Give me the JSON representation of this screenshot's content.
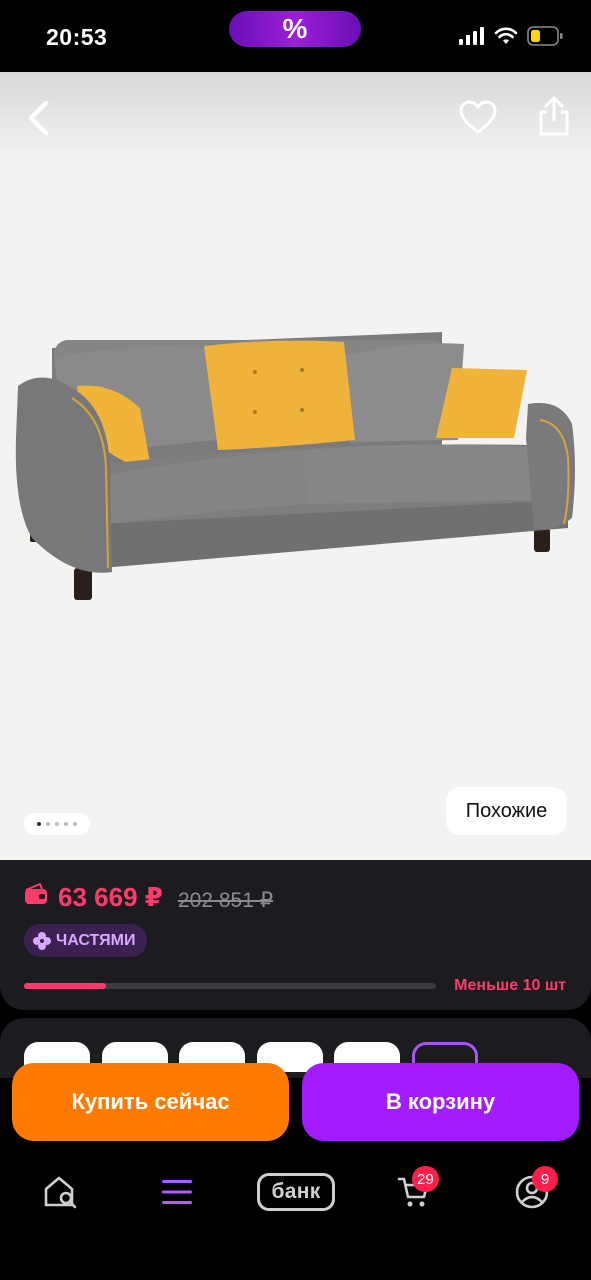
{
  "status_bar": {
    "time": "20:53",
    "promo_symbol": "%",
    "icons": [
      "signal-icon",
      "wifi-icon",
      "battery-icon"
    ]
  },
  "gallery": {
    "image": "grey-sofa-with-yellow-pillows",
    "total_images": 5,
    "active_index": 0,
    "similar_label": "Похожие",
    "icons": [
      "back-icon",
      "heart-icon",
      "share-icon"
    ]
  },
  "price": {
    "current": "63 669 ₽",
    "old": "202 851 ₽",
    "parts_label": "ЧАСТЯМИ",
    "stock_label": "Меньше 10 шт",
    "stock_level": 0.2,
    "accent_color": "#ff3b6b"
  },
  "actions": {
    "buy_now_label": "Купить сейчас",
    "buy_now_color": "#ff7a00",
    "add_to_cart_label": "В корзину",
    "add_to_cart_color": "#a21cff"
  },
  "bottom_nav": {
    "items": [
      {
        "name": "home",
        "icon": "home-search-icon"
      },
      {
        "name": "catalog",
        "icon": "menu-icon"
      },
      {
        "name": "bank",
        "label": "банк"
      },
      {
        "name": "cart",
        "icon": "cart-icon",
        "badge": "29"
      },
      {
        "name": "profile",
        "icon": "profile-icon",
        "badge": "9"
      }
    ]
  }
}
